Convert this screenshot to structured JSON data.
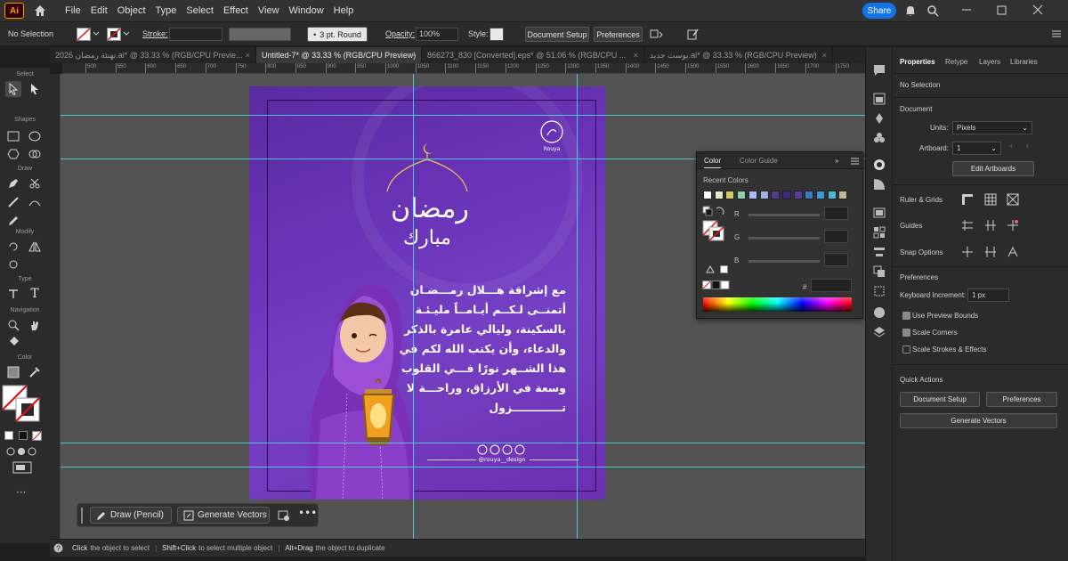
{
  "app": {
    "logo": "Ai",
    "share_label": "Share"
  },
  "menu": [
    "File",
    "Edit",
    "Object",
    "Type",
    "Select",
    "Effect",
    "View",
    "Window",
    "Help"
  ],
  "control_bar": {
    "selection": "No Selection",
    "stroke_label": "Stroke:",
    "brush": "3 pt. Round",
    "opacity_label": "Opacity:",
    "opacity_value": "100%",
    "style_label": "Style:",
    "document_setup": "Document Setup",
    "preferences": "Preferences"
  },
  "tabs": [
    {
      "label": "تهنئة رمضان 2026.ai* @ 33.33 % (RGB/CPU Previe...",
      "active": false
    },
    {
      "label": "Untitled-7* @ 33.33 % (RGB/CPU Preview)",
      "active": true
    },
    {
      "label": "866273_830 [Converted].eps* @ 51.06 % (RGB/CPU ...",
      "active": false
    },
    {
      "label": "بوست جديد.ai* @ 33.33 % (RGB/CPU Preview)",
      "active": false
    }
  ],
  "toolbar_sections": {
    "select": "Select",
    "shapes": "Shapes",
    "draw": "Draw",
    "modify": "Modify",
    "type": "Type",
    "navigation": "Navigation",
    "color": "Color"
  },
  "ruler_ticks": [
    "500",
    "550",
    "600",
    "650",
    "700",
    "750",
    "800",
    "850",
    "900",
    "950",
    "1000",
    "1050",
    "1100",
    "1150",
    "1200",
    "1250",
    "1300",
    "1350",
    "1400",
    "1450",
    "1500",
    "1550",
    "1600",
    "1650",
    "1700",
    "1750"
  ],
  "artboard": {
    "title_line1": "رمضان",
    "title_line2": "مبارك",
    "logo_text": "رؤية",
    "logo_sub": "Rouya",
    "body_lines": [
      "مع إشراقة هـــلال رمـــضـان",
      "أتمنــى لـكــم أيـامــاً مليـئـة",
      "بالسكينة، وليالي عامرة بالذكر",
      "والدعاء، وأن يكتب الله لكم في",
      "هذا الشــهر نورًا فـــي القلوب",
      "وسعة في الأرزاق، وراحـــة لا",
      "تـــــــــــــزول"
    ],
    "handle": "@rouya__design",
    "bg_colors": [
      "#5a2aa0",
      "#7640c4"
    ]
  },
  "float_bar": {
    "draw": "Draw (Pencil)",
    "generate": "Generate Vectors"
  },
  "status_bar": {
    "click": "Click",
    "click_text": "the object to select",
    "shift": "Shift+Click",
    "shift_text": "to select multiple object",
    "alt": "Alt+Drag",
    "alt_text": "the object to duplicate"
  },
  "color_panel": {
    "tab_color": "Color",
    "tab_guide": "Color Guide",
    "recent_label": "Recent Colors",
    "recent_colors": [
      "#ffffff",
      "#e6e6c8",
      "#d4c86a",
      "#8fd0a8",
      "#b0b8ff",
      "#9fb0e8",
      "#503a8c",
      "#3c2a7a",
      "#5a3aa0",
      "#3a7ac8",
      "#3a9ad8",
      "#4ab8d8",
      "#c8b898"
    ],
    "r_label": "R",
    "g_label": "G",
    "b_label": "B",
    "hex_label": "#"
  },
  "properties": {
    "tabs": [
      "Properties",
      "Retype",
      "Layers",
      "Libraries"
    ],
    "no_selection": "No Selection",
    "document_label": "Document",
    "units_label": "Units:",
    "units_value": "Pixels",
    "artboard_label": "Artboard:",
    "artboard_value": "1",
    "edit_artboards": "Edit Artboards",
    "rulers_grids": "Ruler & Grids",
    "guides": "Guides",
    "snap_options": "Snap Options",
    "preferences_label": "Preferences",
    "keyboard_increment_label": "Keyboard Increment:",
    "keyboard_increment_value": "1 px",
    "use_preview_bounds": "Use Preview Bounds",
    "scale_corners": "Scale Corners",
    "scale_strokes": "Scale Strokes & Effects",
    "quick_actions": "Quick Actions",
    "document_setup": "Document Setup",
    "preferences_btn": "Preferences",
    "generate_vectors": "Generate Vectors"
  }
}
